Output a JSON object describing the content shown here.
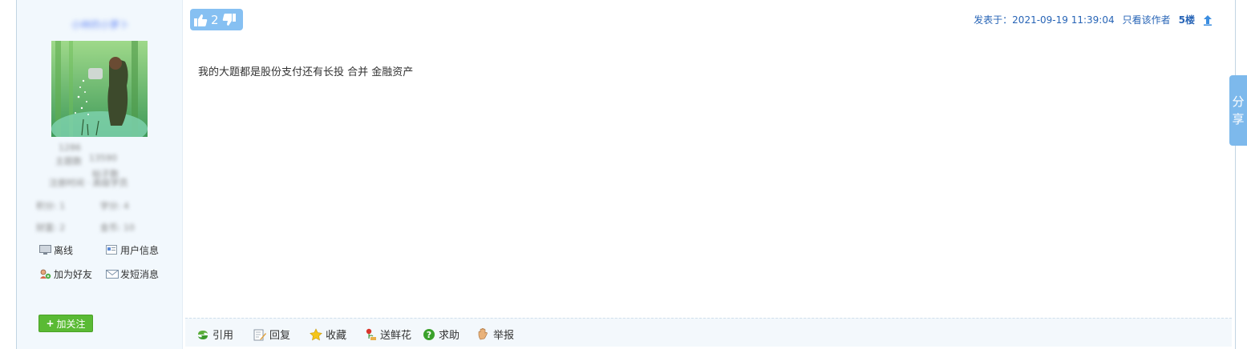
{
  "sidebar": {
    "username": "小林的小萝卜",
    "stats_top": [
      "主题数",
      "帖子数"
    ],
    "stats_vals": [
      "1286",
      "13590"
    ],
    "level": "注册时间 · 高级学员",
    "stat_grid": [
      [
        "积分: 1",
        "学分: 4"
      ],
      [
        "财富: 2",
        "金币: 10"
      ]
    ],
    "links": {
      "offline": "离线",
      "user_info": "用户信息",
      "add_friend": "加为好友",
      "send_message": "发短消息"
    },
    "follow_button": "加关注"
  },
  "post": {
    "like_count": "2",
    "posted_label": "发表于：2021-09-19 11:39:04",
    "only_author": "只看该作者",
    "floor": "5楼",
    "content": "我的大题都是股份支付还有长投 合并 金融资产"
  },
  "actions": [
    "引用",
    "回复",
    "收藏",
    "送鲜花",
    "求助",
    "举报"
  ],
  "share": [
    "分",
    "享"
  ],
  "colors": {
    "accent_blue": "#2764b6",
    "like_bg": "#86c0f2",
    "follow_green": "#5aba34",
    "share_bg": "#7db9ec"
  }
}
